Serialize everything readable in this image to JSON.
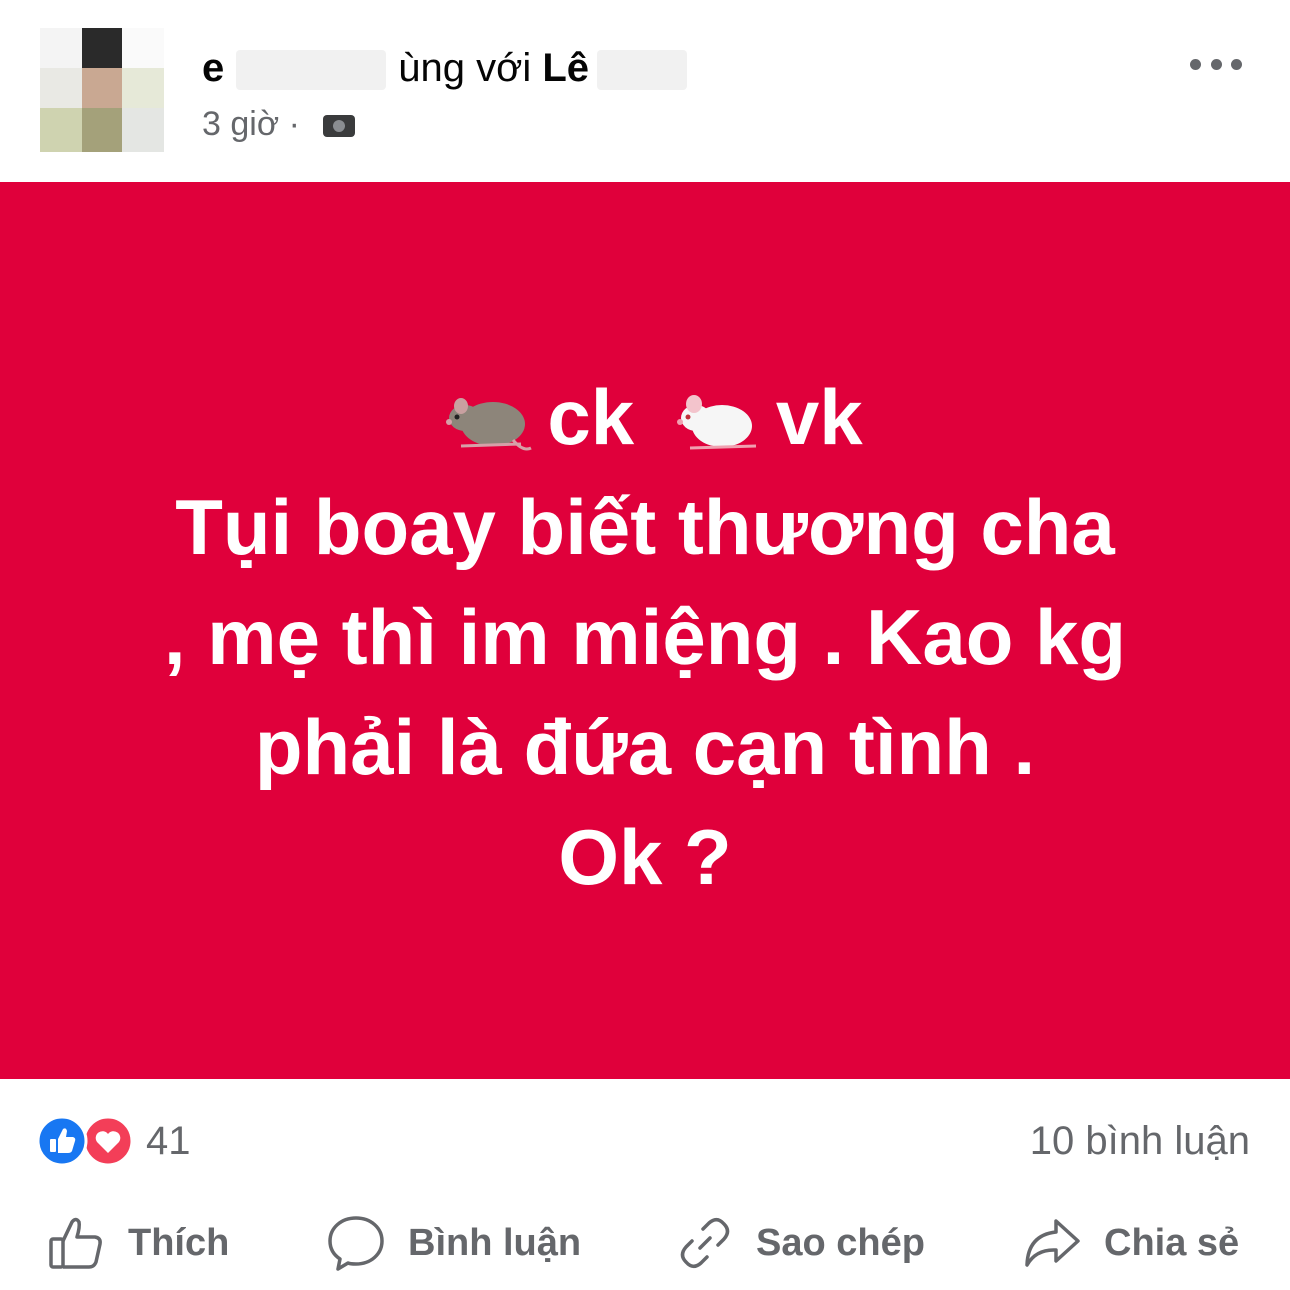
{
  "post": {
    "author_prefix": "e",
    "tag_text": "ùng với",
    "tagged_name": "Lê",
    "time": "3 giờ",
    "separator": "·",
    "content_lines": [
      "ck",
      "vk",
      "Tụi boay biết thương cha",
      ", mẹ thì im miệng . Kao kg",
      "phải là đứa cạn tình .",
      "Ok ?"
    ],
    "emoji": [
      "rat-emoji",
      "mouse-emoji"
    ],
    "background_color": "#e0003b",
    "text_color": "#ffffff"
  },
  "reactions": {
    "icons": [
      "like-icon",
      "love-icon"
    ],
    "count": "41",
    "comments": "10 bình luận"
  },
  "actions": {
    "like": "Thích",
    "comment": "Bình luận",
    "copy": "Sao chép",
    "share": "Chia sẻ"
  },
  "colors": {
    "accent_like": "#1877f2",
    "accent_love": "#f33e58",
    "muted_text": "#65676b"
  }
}
